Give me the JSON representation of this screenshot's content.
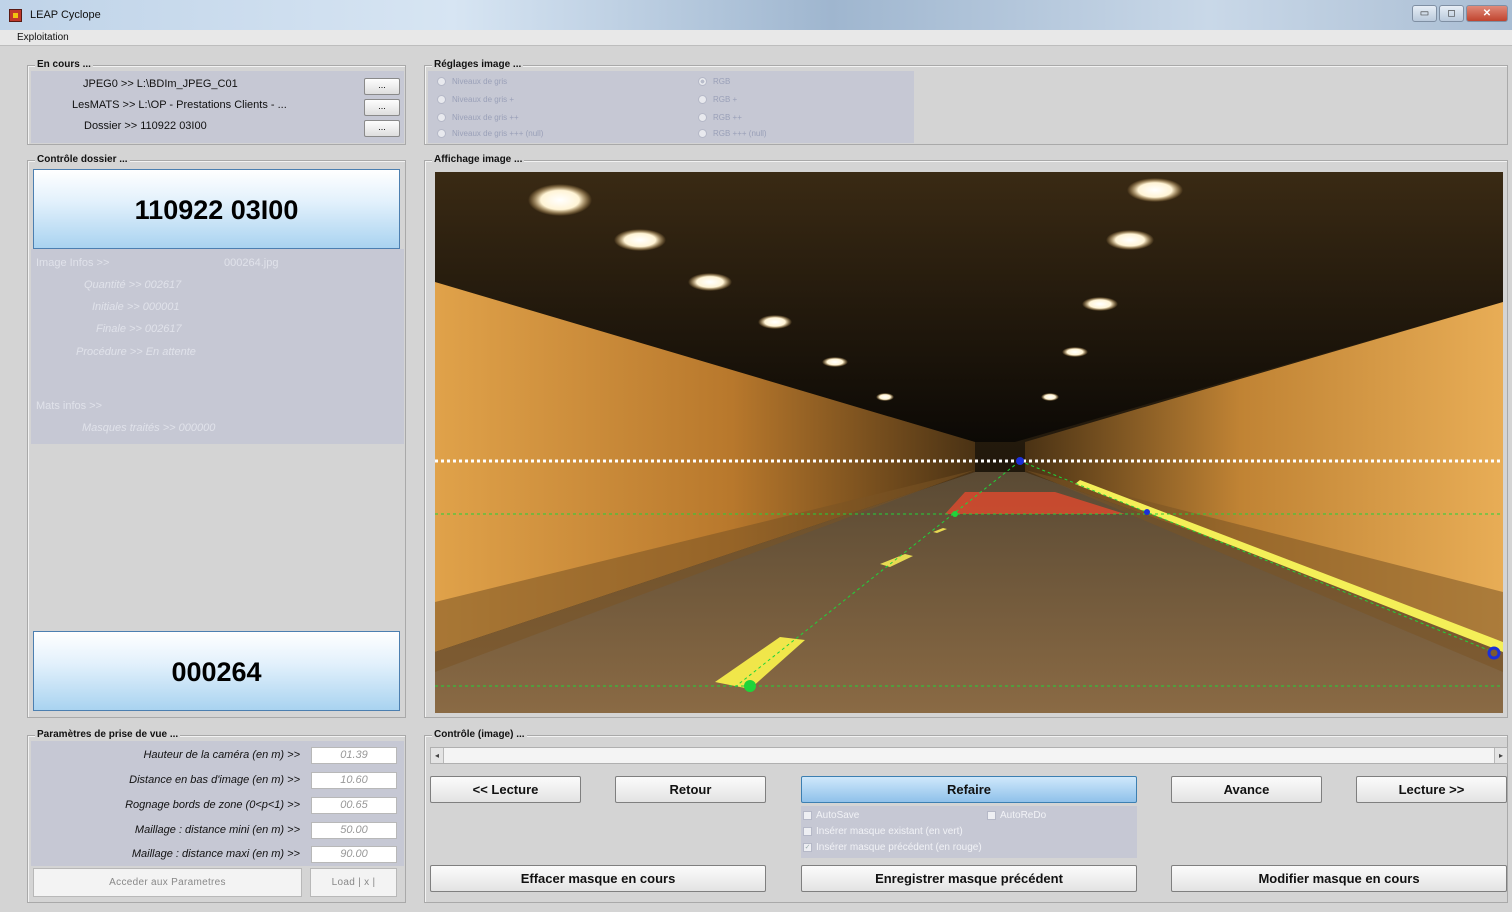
{
  "window": {
    "title": "LEAP Cyclope",
    "minimize": "▭",
    "maximize": "◻",
    "close": "✕"
  },
  "menu": {
    "exploitation": "Exploitation"
  },
  "en_cours": {
    "title": "En cours ...",
    "lines": [
      "JPEG0  >> L:\\BDIm_JPEG_C01",
      "LesMATS >> L:\\OP - Prestations Clients - ...",
      "Dossier >> 110922 03I00"
    ],
    "browse_label": "..."
  },
  "reglages": {
    "title": "Réglages image ...",
    "left_options": [
      "Niveaux de gris",
      "Niveaux de gris +",
      "Niveaux de gris ++",
      "Niveaux de gris +++ (null)"
    ],
    "right_options": [
      "RGB",
      "RGB +",
      "RGB ++",
      "RGB +++ (null)"
    ],
    "selected": "RGB"
  },
  "controle_dossier": {
    "title": "Contrôle dossier ...",
    "folder": "110922 03I00",
    "image_infos_label": "Image Infos >>",
    "image_file": "000264.jpg",
    "quantite": "Quantité >> 002617",
    "initiale": "Initiale >> 000001",
    "finale": "Finale >> 002617",
    "procedure": "Procédure >> En attente",
    "mats_infos_label": "Mats infos >>",
    "masques": "Masques traités >> 000000",
    "current_image": "000264"
  },
  "affichage": {
    "title": "Affichage image ..."
  },
  "parametres": {
    "title": "Paramètres de prise de vue ...",
    "rows": [
      {
        "label": "Hauteur de la caméra (en m) >>",
        "value": "01.39"
      },
      {
        "label": "Distance en bas d'image (en m) >>",
        "value": "10.60"
      },
      {
        "label": "Rognage bords de zone (0<p<1) >>",
        "value": "00.65"
      },
      {
        "label": "Maillage : distance mini (en m) >>",
        "value": "50.00"
      },
      {
        "label": "Maillage : distance maxi (en m) >>",
        "value": "90.00"
      }
    ],
    "acceder_label": "Acceder aux Parametres",
    "load_label": "Load | x |"
  },
  "controle_image": {
    "title": "Contrôle (image) ...",
    "scroll_left": "◂",
    "scroll_right": "▸",
    "buttons": {
      "lecture_back": "<< Lecture",
      "retour": "Retour",
      "refaire": "Refaire",
      "avance": "Avance",
      "lecture_fwd": "Lecture >>",
      "effacer": "Effacer masque en cours",
      "enregistrer": "Enregistrer masque précédent",
      "modifier": "Modifier masque en cours"
    },
    "options": {
      "autosave": "AutoSave",
      "autoredo": "AutoReDo",
      "inserer_existant": "Insérer masque existant (en vert)",
      "inserer_precedent": "Insérer masque précédent (en rouge)"
    }
  },
  "colors": {
    "accent_blue": "#a9d3f0",
    "mask_red": "#d84a2e",
    "mask_green": "#1fd43a",
    "mask_blue": "#1b2fd8"
  }
}
